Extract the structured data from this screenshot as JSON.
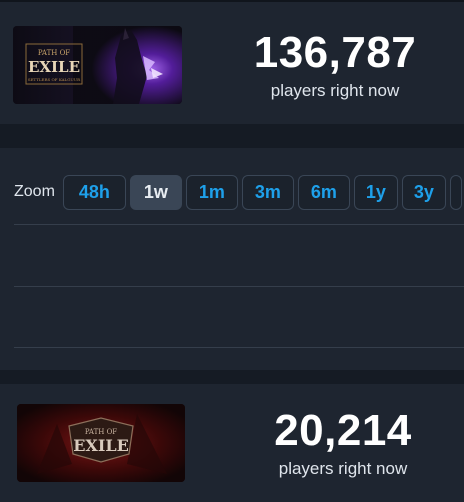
{
  "games": [
    {
      "count": "136,787",
      "caption": "players right now",
      "logo_text": "PATH OF EXILE",
      "logo_subtext": "SETTLERS OF KALGUUR"
    },
    {
      "count": "20,214",
      "caption": "players right now",
      "logo_text": "EXILE",
      "logo_subtext": "PATH OF"
    }
  ],
  "zoom": {
    "label": "Zoom",
    "options": [
      "48h",
      "1w",
      "1m",
      "3m",
      "6m",
      "1y",
      "3y"
    ],
    "selected": "1w"
  },
  "colors": {
    "accent": "#1ea0ea",
    "card": "#1e2530",
    "page": "#151b24"
  }
}
